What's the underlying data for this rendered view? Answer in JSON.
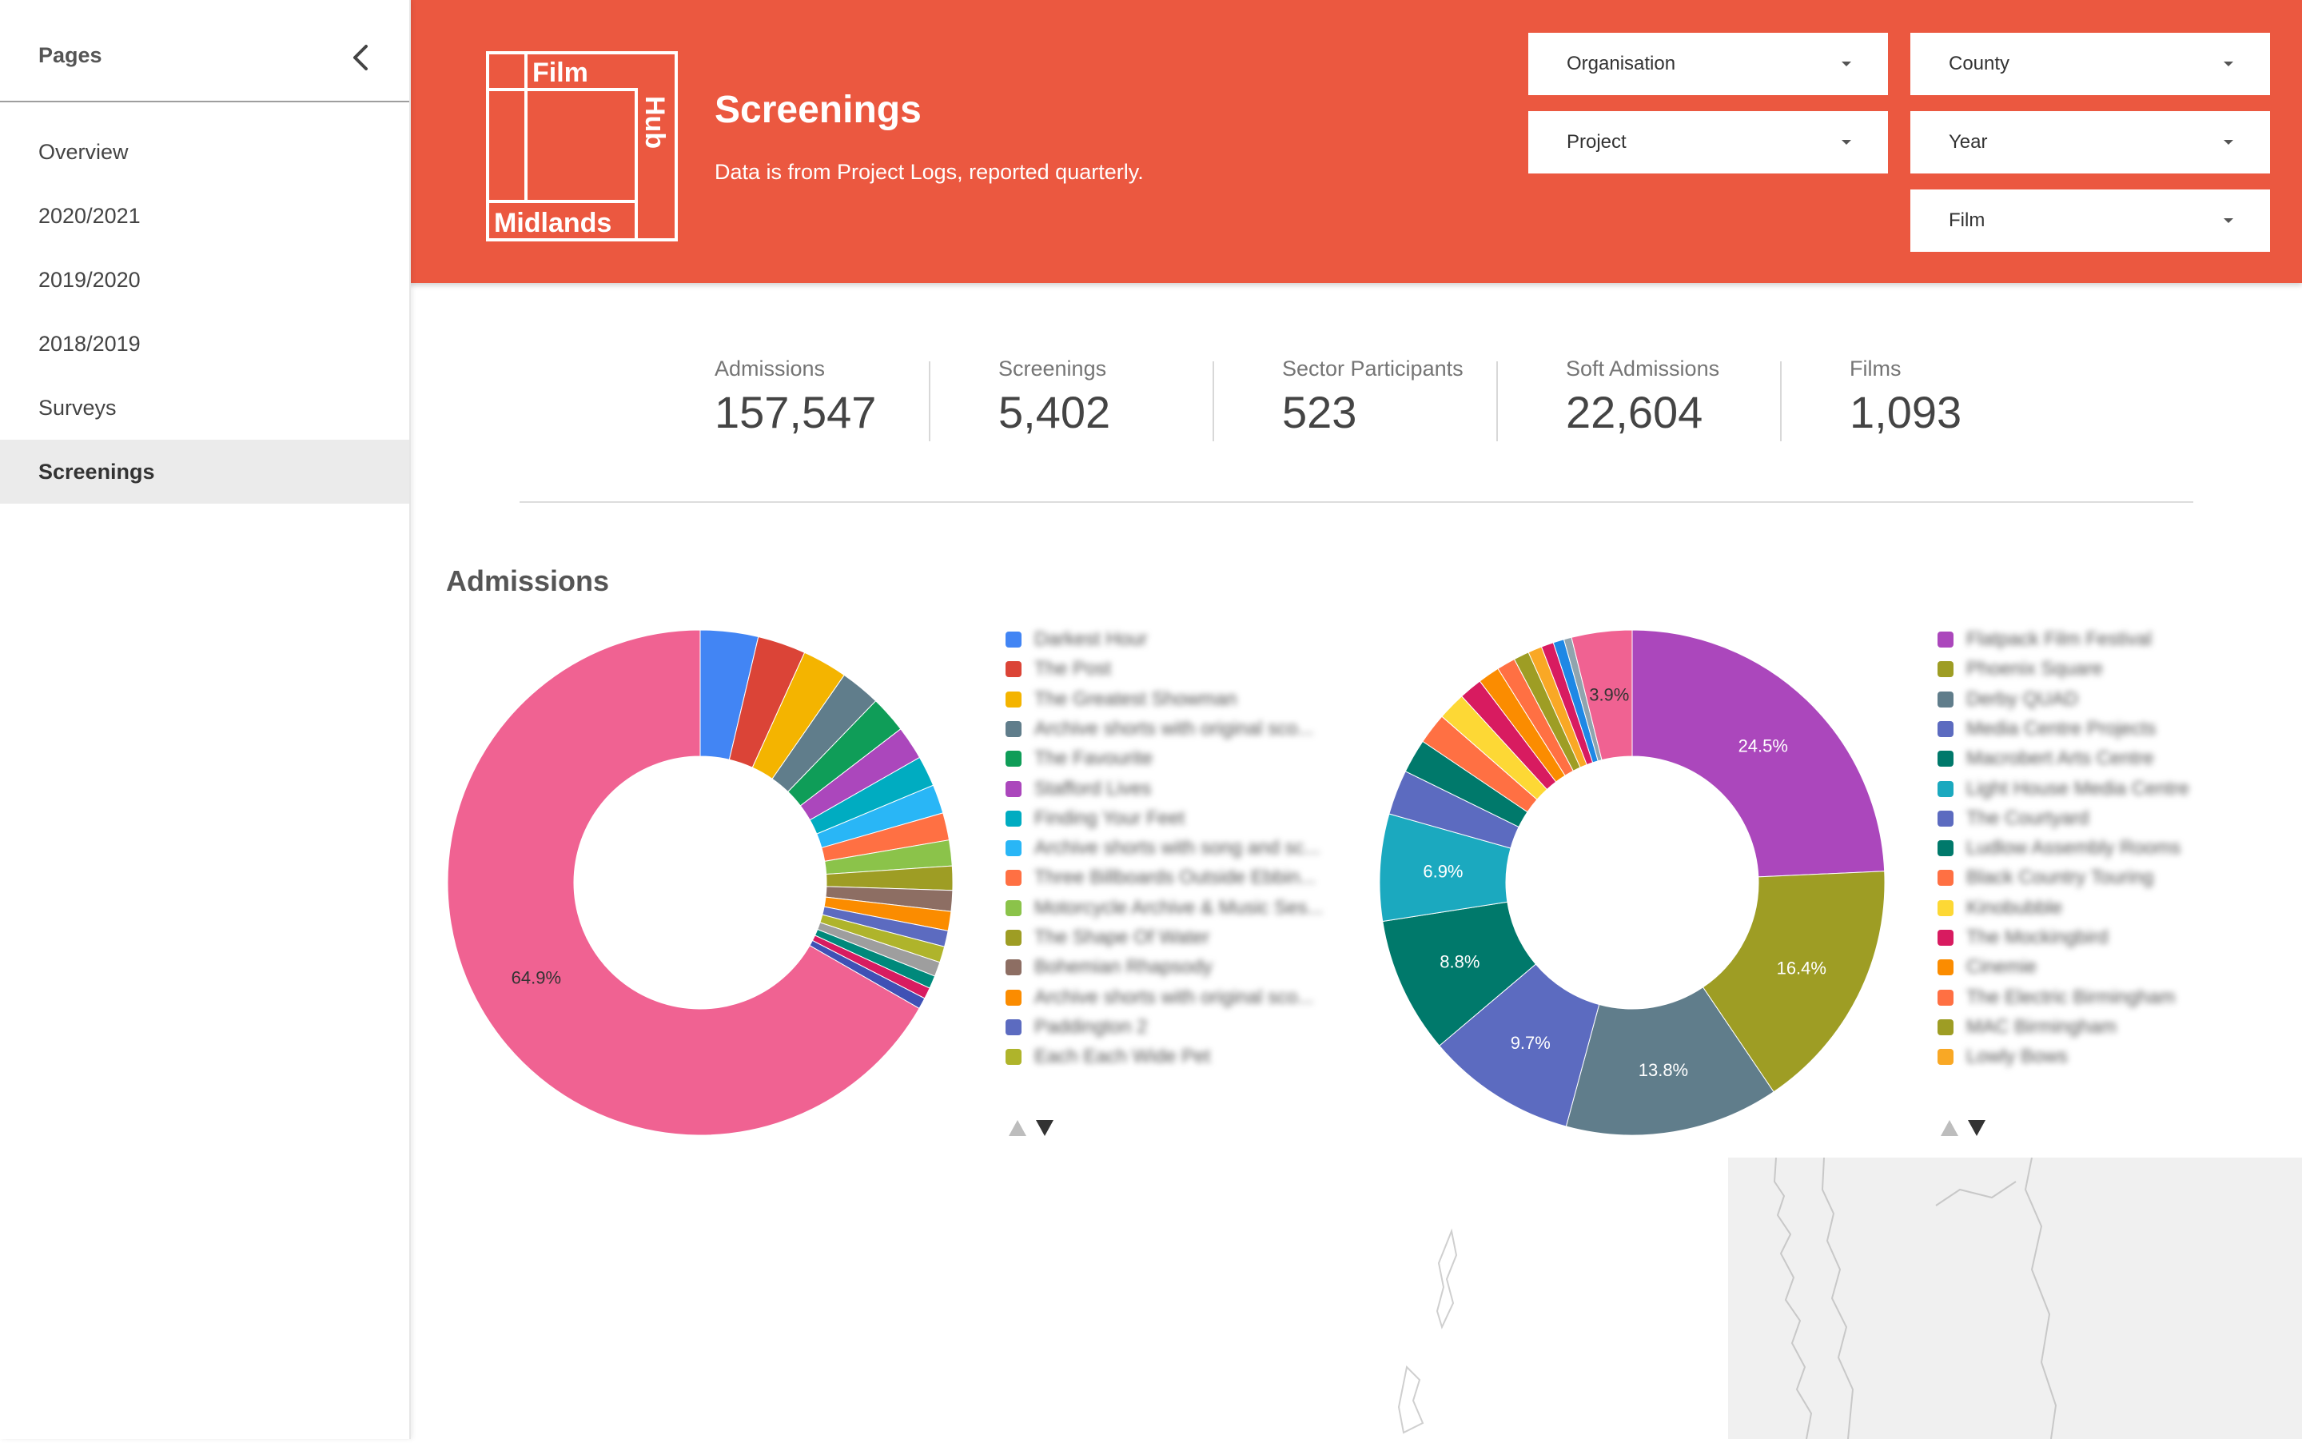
{
  "sidebar": {
    "title": "Pages",
    "items": [
      {
        "label": "Overview",
        "active": false
      },
      {
        "label": "2020/2021",
        "active": false
      },
      {
        "label": "2019/2020",
        "active": false
      },
      {
        "label": "2018/2019",
        "active": false
      },
      {
        "label": "Surveys",
        "active": false
      },
      {
        "label": "Screenings",
        "active": true
      }
    ]
  },
  "header": {
    "background": "#eb5840",
    "logo_words": [
      "Film",
      "Hub",
      "Midlands"
    ],
    "title": "Screenings",
    "subtitle": "Data is from Project Logs, reported quarterly.",
    "filters": {
      "organisation": "Organisation",
      "county": "County",
      "project": "Project",
      "year": "Year",
      "film": "Film"
    }
  },
  "kpis": [
    {
      "label": "Admissions",
      "value": "157,547"
    },
    {
      "label": "Screenings",
      "value": "5,402"
    },
    {
      "label": "Sector Participants",
      "value": "523"
    },
    {
      "label": "Soft Admissions",
      "value": "22,604"
    },
    {
      "label": "Films",
      "value": "1,093"
    }
  ],
  "section": {
    "title": "Admissions"
  },
  "chart_data": [
    {
      "type": "pie",
      "donut": true,
      "legend_position": "right",
      "legend_blurred": true,
      "series": [
        {
          "value": 3.6,
          "color": "#4285f4"
        },
        {
          "value": 3.0,
          "color": "#db4437"
        },
        {
          "value": 2.8,
          "color": "#f4b400"
        },
        {
          "value": 2.5,
          "color": "#607d8b"
        },
        {
          "value": 2.3,
          "color": "#0f9d58"
        },
        {
          "value": 2.1,
          "color": "#ab47bc"
        },
        {
          "value": 1.9,
          "color": "#00acc1"
        },
        {
          "value": 1.8,
          "color": "#29b6f6"
        },
        {
          "value": 1.7,
          "color": "#ff7043"
        },
        {
          "value": 1.6,
          "color": "#8bc34a"
        },
        {
          "value": 1.5,
          "color": "#9e9d24"
        },
        {
          "value": 1.3,
          "color": "#8d6e63"
        },
        {
          "value": 1.2,
          "color": "#fb8c00"
        },
        {
          "value": 1.0,
          "color": "#5c6bc0"
        },
        {
          "value": 1.0,
          "color": "#afb42b"
        },
        {
          "value": 0.9,
          "color": "#9e9e9e"
        },
        {
          "value": 0.8,
          "color": "#00897b"
        },
        {
          "value": 0.7,
          "color": "#d81b60"
        },
        {
          "value": 0.7,
          "color": "#3f51b5"
        },
        {
          "value": 64.9,
          "color": "#f06292",
          "label": "64.9%"
        }
      ],
      "legend_texts": [
        "Darkest Hour",
        "The Post",
        "The Greatest Showman",
        "Archive shorts with original sco...",
        "The Favourite",
        "Stafford Lives",
        "Finding Your Feet",
        "Archive shorts with song and sc...",
        "Three Billboards Outside Ebbin...",
        "Motorcycle Archive & Music Ses...",
        "The Shape Of Water",
        "Bohemian Rhapsody",
        "Archive shorts with original sco...",
        "Paddington 2",
        "Each Each Wide Pet"
      ]
    },
    {
      "type": "pie",
      "donut": true,
      "legend_position": "right",
      "legend_blurred": true,
      "series": [
        {
          "value": 24.5,
          "color": "#ab47bc",
          "label": "24.5%"
        },
        {
          "value": 16.4,
          "color": "#9e9d24",
          "label": "16.4%"
        },
        {
          "value": 13.8,
          "color": "#607d8b",
          "label": "13.8%"
        },
        {
          "value": 9.7,
          "color": "#5c6bc0",
          "label": "9.7%"
        },
        {
          "value": 8.8,
          "color": "#00796b",
          "label": "8.8%"
        },
        {
          "value": 6.9,
          "color": "#1ba9bf",
          "label": "6.9%"
        },
        {
          "value": 2.9,
          "color": "#5c6bc0"
        },
        {
          "value": 2.2,
          "color": "#00796b"
        },
        {
          "value": 2.0,
          "color": "#ff7043"
        },
        {
          "value": 1.8,
          "color": "#fdd835"
        },
        {
          "value": 1.5,
          "color": "#d81b60"
        },
        {
          "value": 1.4,
          "color": "#fb8c00"
        },
        {
          "value": 1.2,
          "color": "#ff7043"
        },
        {
          "value": 1.0,
          "color": "#9e9d24"
        },
        {
          "value": 0.9,
          "color": "#f9a825"
        },
        {
          "value": 0.8,
          "color": "#d81b60"
        },
        {
          "value": 0.7,
          "color": "#1e88e5"
        },
        {
          "value": 0.5,
          "color": "#90a4ae"
        },
        {
          "value": 3.9,
          "color": "#f06292",
          "label": "3.9%"
        }
      ],
      "legend_texts": [
        "Flatpack Film Festival",
        "Phoenix Square",
        "Derby QUAD",
        "Media Centre Projects",
        "Macrobert Arts Centre",
        "Light House Media Centre",
        "The Courtyard",
        "Ludlow Assembly Rooms",
        "Black Country Touring",
        "Kinobubble",
        "The Mockingbird",
        "Cinemie",
        "The Electric Birmingham",
        "MAC Birmingham",
        "Lowly Bows"
      ],
      "legend_colors": [
        "#ab47bc",
        "#9e9d24",
        "#607d8b",
        "#5c6bc0",
        "#00796b",
        "#1ba9bf",
        "#5c6bc0",
        "#00796b",
        "#ff7043",
        "#fdd835",
        "#d81b60",
        "#fb8c00",
        "#ff7043",
        "#9e9d24",
        "#f9a825"
      ]
    }
  ]
}
